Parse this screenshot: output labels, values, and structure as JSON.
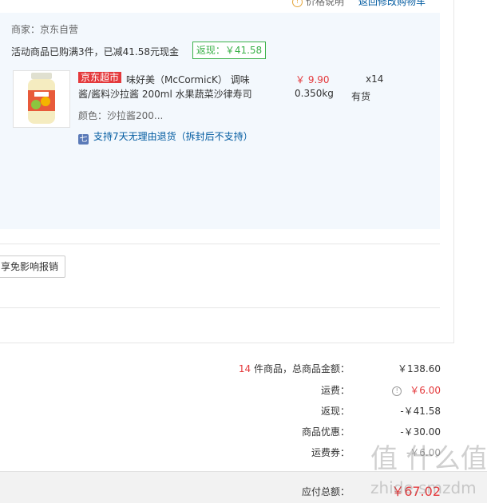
{
  "header": {
    "price_note": "价格说明",
    "back_link": "返回修改购物车"
  },
  "shop": {
    "merchant": "商家：京东自营",
    "promo": "活动商品已购满3件，已减41.58元现金",
    "cashback_badge": "返现：￥41.58"
  },
  "product": {
    "tag": "京东超市",
    "name_line1": "味好美（McCormicK） 调味",
    "name_line2": "酱/酱料沙拉酱 200ml 水果蔬菜沙律寿司",
    "price": "￥ 9.90",
    "qty": "x14",
    "weight": "0.350kg",
    "stock": "有货",
    "color": "颜色：沙拉酱200...",
    "return_policy": "支持7天无理由退货（拆封后不支持）"
  },
  "buttons": {
    "exempt": "享免影响报销"
  },
  "summary": {
    "count": "14",
    "count_suffix": " 件商品，总商品金额：",
    "total": "￥138.60",
    "shipping_label": "运费：",
    "shipping": "￥6.00",
    "cashback_label": "返现：",
    "cashback": "-￥41.58",
    "discount_label": "商品优惠：",
    "discount": "-￥30.00",
    "coupon_label": "运费券：",
    "coupon": "-￥6.00",
    "pay_label": "应付总额：",
    "pay": "￥67.02"
  },
  "watermark": {
    "text": "值 什么值得买",
    "url": "zhide.smzdm"
  },
  "colors": {
    "price_red": "#e4393c",
    "link_blue": "#005aa0",
    "panel_bg": "#f3f8fd",
    "cashback_green": "#3bb14a"
  }
}
